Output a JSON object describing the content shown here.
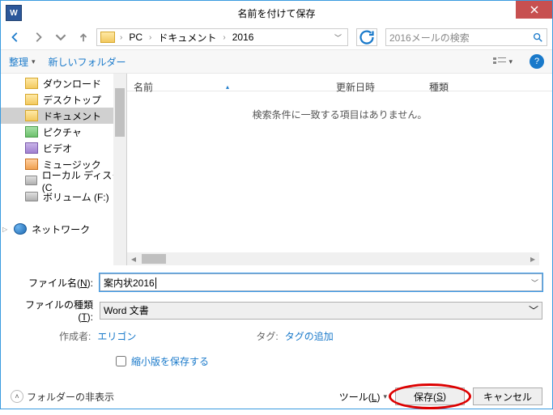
{
  "title": "名前を付けて保存",
  "breadcrumb": {
    "pc": "PC",
    "docs": "ドキュメント",
    "year": "2016"
  },
  "search": {
    "placeholder": "2016メールの検索"
  },
  "toolbar": {
    "organize": "整理",
    "newfolder": "新しいフォルダー"
  },
  "tree": {
    "downloads": "ダウンロード",
    "desktop": "デスクトップ",
    "documents": "ドキュメント",
    "pictures": "ピクチャ",
    "videos": "ビデオ",
    "music": "ミュージック",
    "localdisk": "ローカル ディスク (C",
    "volume": "ボリューム (F:)",
    "network": "ネットワーク"
  },
  "columns": {
    "name": "名前",
    "date": "更新日時",
    "type": "種類"
  },
  "empty": "検索条件に一致する項目はありません。",
  "fields": {
    "filename_lbl_pre": "ファイル名(",
    "filename_lbl_u": "N",
    "filename_lbl_post": "):",
    "filename_val": "案内状2016",
    "filetype_lbl_pre": "ファイルの種類(",
    "filetype_lbl_u": "T",
    "filetype_lbl_post": "):",
    "filetype_val": "Word 文書"
  },
  "meta": {
    "author_lbl": "作成者:",
    "author_val": "エリゴン",
    "tag_lbl": "タグ:",
    "tag_val": "タグの追加"
  },
  "thumb_check": "縮小版を保存する",
  "footer": {
    "hide": "フォルダーの非表示",
    "tools_pre": "ツール(",
    "tools_u": "L",
    "tools_post": ")",
    "save_pre": "保存(",
    "save_u": "S",
    "save_post": ")",
    "cancel": "キャンセル"
  }
}
